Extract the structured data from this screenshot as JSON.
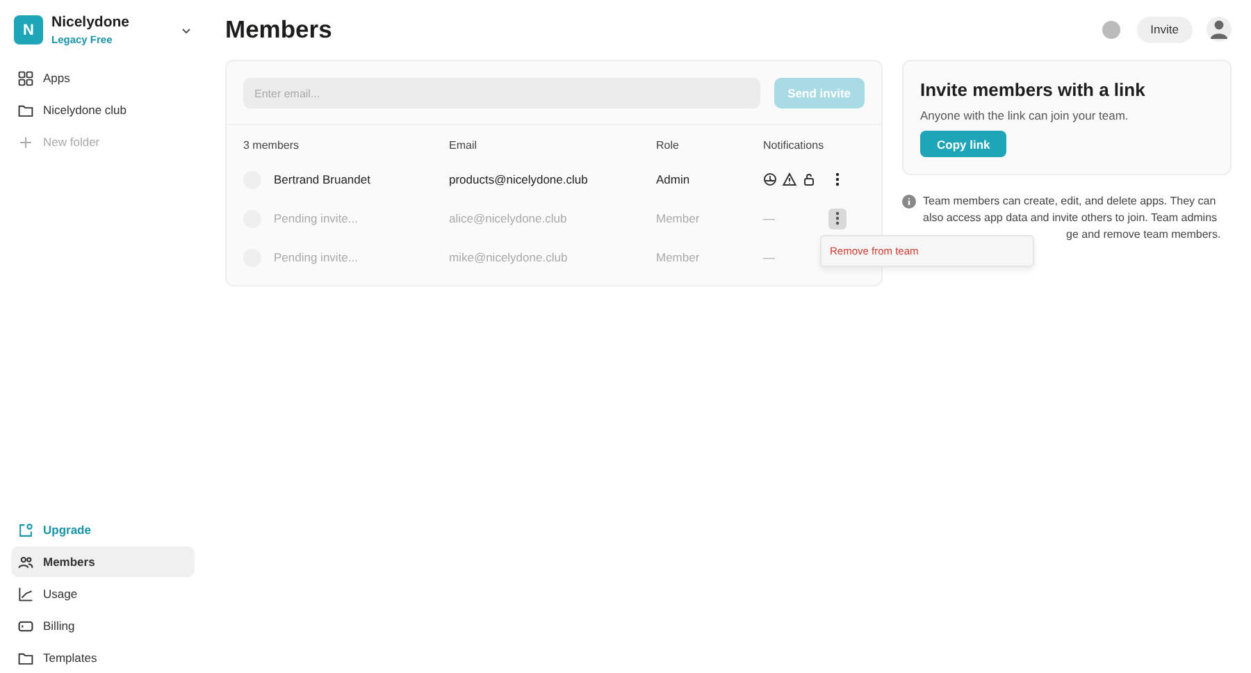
{
  "workspace": {
    "initial": "N",
    "name": "Nicelydone",
    "plan": "Legacy Free"
  },
  "sidebar": {
    "top_items": [
      {
        "label": "Apps",
        "kind": "link"
      },
      {
        "label": "Nicelydone club",
        "kind": "link"
      },
      {
        "label": "New folder",
        "kind": "add"
      }
    ],
    "bottom_items": [
      {
        "label": "Upgrade",
        "kind": "accent",
        "selected": false
      },
      {
        "label": "Members",
        "kind": "link",
        "selected": true
      },
      {
        "label": "Usage",
        "kind": "link",
        "selected": false
      },
      {
        "label": "Billing",
        "kind": "link",
        "selected": false
      },
      {
        "label": "Templates",
        "kind": "link",
        "selected": false
      }
    ]
  },
  "page": {
    "title": "Members",
    "invite_button": "Invite"
  },
  "invite_form": {
    "placeholder": "Enter email...",
    "button": "Send invite",
    "disabled": true
  },
  "table": {
    "columns": [
      "3 members",
      "Email",
      "Role",
      "Notifications"
    ],
    "rows": [
      {
        "name": "Bertrand Bruandet",
        "email": "products@nicelydone.club",
        "role": "Admin",
        "kind": "active",
        "menu_open": false
      },
      {
        "name": "Pending invite...",
        "email": "alice@nicelydone.club",
        "role": "Member",
        "notifications": "—",
        "kind": "pending",
        "menu_open": true
      },
      {
        "name": "Pending invite...",
        "email": "mike@nicelydone.club",
        "role": "Member",
        "notifications": "—",
        "kind": "pending",
        "menu_open": false
      }
    ]
  },
  "row_menu": {
    "items": [
      "Remove from team"
    ]
  },
  "link_card": {
    "title": "Invite members with a link",
    "text": "Anyone with the link can join your team.",
    "button": "Copy link"
  },
  "info": {
    "lines": [
      "Team members can create, edit, and delete apps. They can",
      "also access app data and invite others to join. Team admins",
      "ge and remove team members."
    ]
  }
}
